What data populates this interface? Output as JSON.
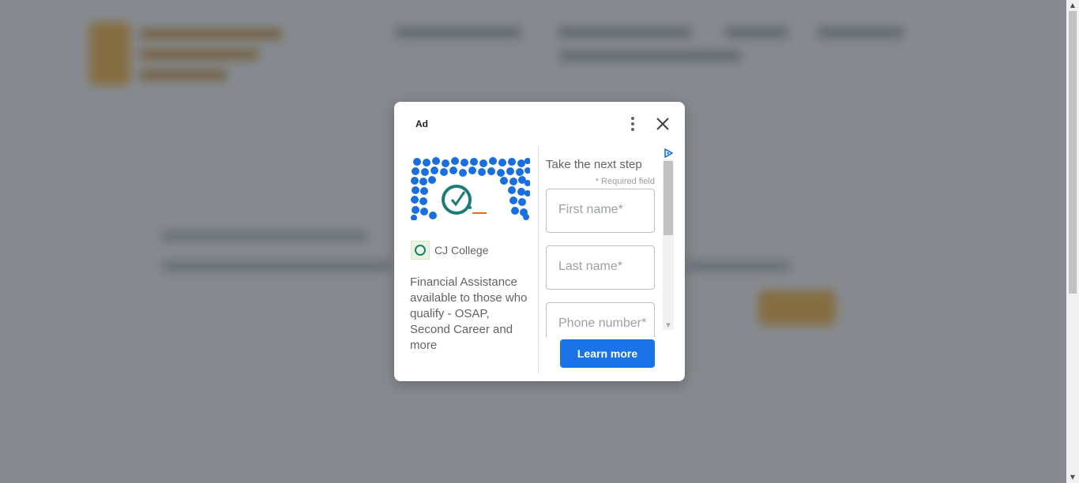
{
  "ad": {
    "label": "Ad",
    "advertiser": "CJ College",
    "description": "Financial Assistance available to those who qualify - OSAP, Second Career and more",
    "form_title": "Take the next step",
    "required_note": "* Required field",
    "fields": {
      "first_name_placeholder": "First name*",
      "last_name_placeholder": "Last name*",
      "phone_placeholder": "Phone number*"
    },
    "cta": "Learn more",
    "icons": {
      "menu": "more-vert-icon",
      "close": "close-icon",
      "adchoices": "adchoices-icon"
    }
  },
  "colors": {
    "overlay": "#424850",
    "cta_bg": "#1a73e8",
    "text_muted": "#5f6368"
  }
}
